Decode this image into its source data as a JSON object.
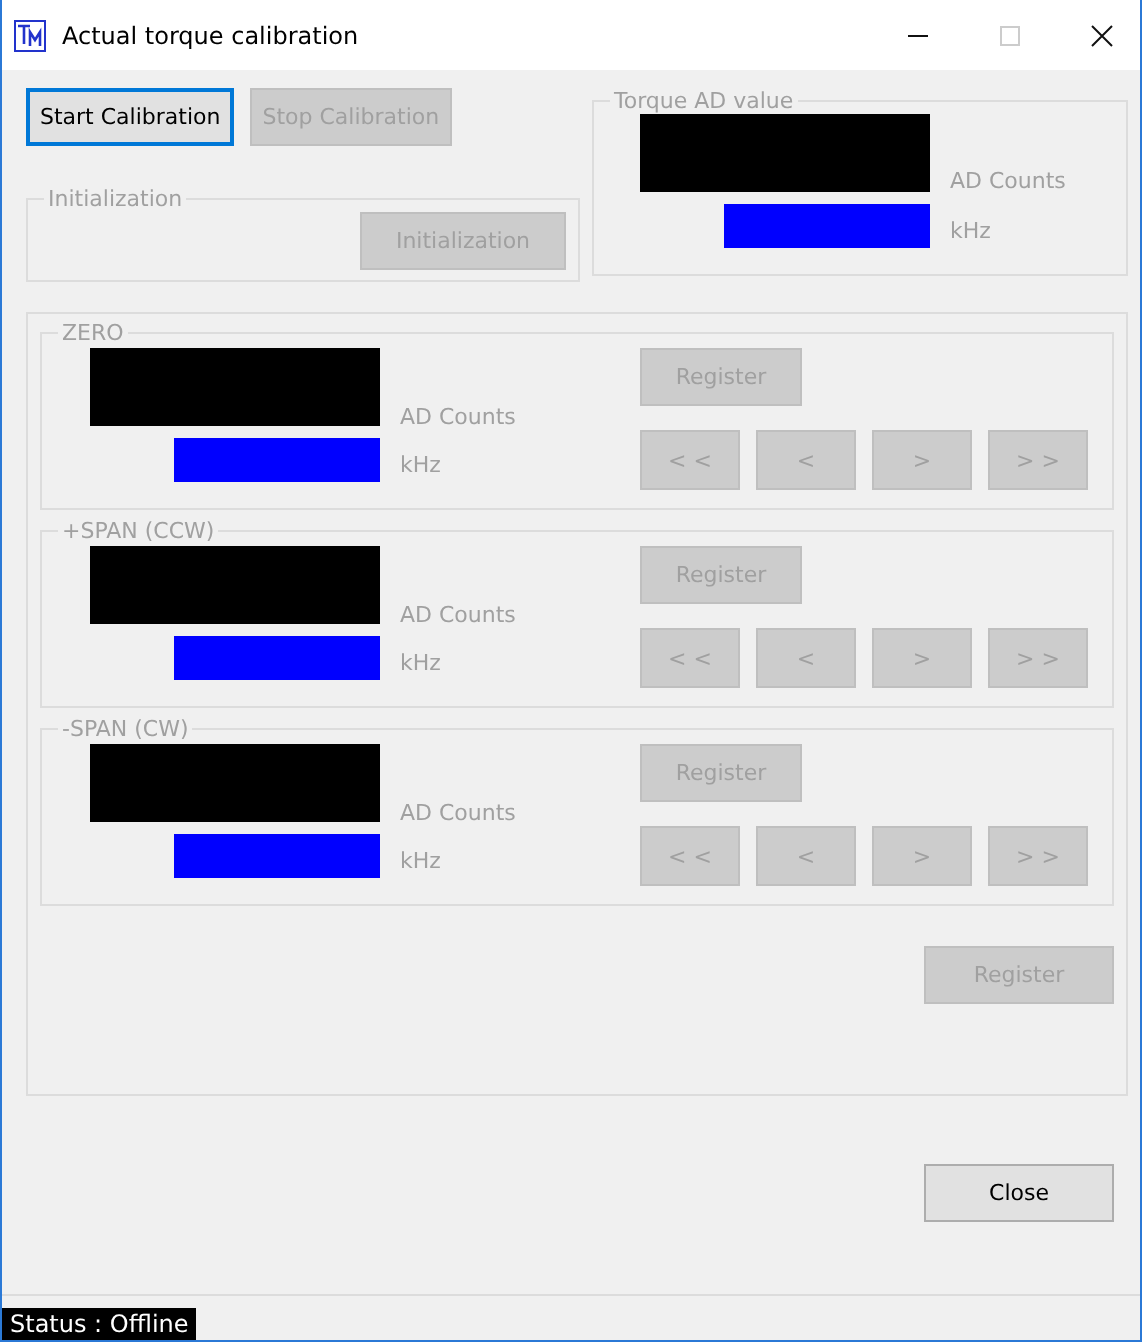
{
  "window": {
    "title": "Actual torque calibration"
  },
  "top_buttons": [
    {
      "label": "Start Calibration",
      "disabled": false,
      "focused": true
    },
    {
      "label": "Stop Calibration",
      "disabled": true,
      "focused": false
    }
  ],
  "initialization": {
    "title": "Initialization",
    "disabled": true,
    "button": {
      "label": "Initialization",
      "disabled": true
    }
  },
  "torque_ad": {
    "title": "Torque AD value",
    "disabled": true,
    "count_unit": "AD Counts",
    "freq_unit": "kHz"
  },
  "sections": [
    {
      "title": "ZERO",
      "disabled": true,
      "count_unit": "AD Counts",
      "freq_unit": "kHz",
      "register": {
        "label": "Register",
        "disabled": true
      },
      "steps": [
        {
          "label": "< <",
          "disabled": true
        },
        {
          "label": "<",
          "disabled": true
        },
        {
          "label": ">",
          "disabled": true
        },
        {
          "label": "> >",
          "disabled": true
        }
      ]
    },
    {
      "title": "+SPAN (CCW)",
      "disabled": true,
      "count_unit": "AD Counts",
      "freq_unit": "kHz",
      "register": {
        "label": "Register",
        "disabled": true
      },
      "steps": [
        {
          "label": "< <",
          "disabled": true
        },
        {
          "label": "<",
          "disabled": true
        },
        {
          "label": ">",
          "disabled": true
        },
        {
          "label": "> >",
          "disabled": true
        }
      ]
    },
    {
      "title": "-SPAN (CW)",
      "disabled": true,
      "count_unit": "AD Counts",
      "freq_unit": "kHz",
      "register": {
        "label": "Register",
        "disabled": true
      },
      "steps": [
        {
          "label": "< <",
          "disabled": true
        },
        {
          "label": "<",
          "disabled": true
        },
        {
          "label": ">",
          "disabled": true
        },
        {
          "label": "> >",
          "disabled": true
        }
      ]
    }
  ],
  "register": {
    "label": "Register",
    "disabled": true
  },
  "close": {
    "label": "Close",
    "disabled": false
  },
  "status": "Status : Offline"
}
